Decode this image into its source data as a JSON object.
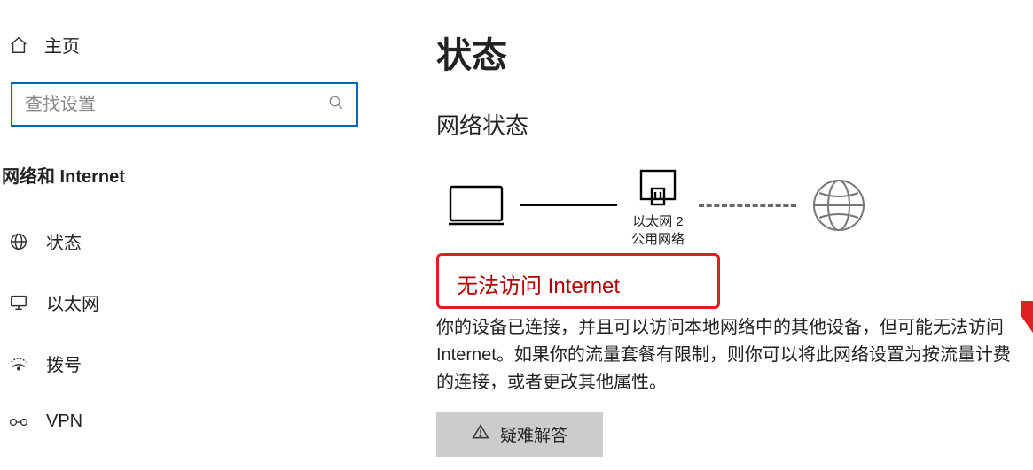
{
  "sidebar": {
    "home_label": "主页",
    "search_placeholder": "查找设置",
    "category_label": "网络和 Internet",
    "items": [
      {
        "label": "状态"
      },
      {
        "label": "以太网"
      },
      {
        "label": "拨号"
      },
      {
        "label": "VPN"
      }
    ]
  },
  "main": {
    "page_title": "状态",
    "section_title": "网络状态",
    "adapter_name": "以太网 2",
    "adapter_profile": "公用网络",
    "highlight": "无法访问 Internet",
    "body": "你的设备已连接，并且可以访问本地网络中的其他设备，但可能无法访问 Internet。如果你的流量套餐有限制，则你可以将此网络设置为按流量计费的连接，或者更改其他属性。",
    "troubleshoot_label": "疑难解答"
  }
}
